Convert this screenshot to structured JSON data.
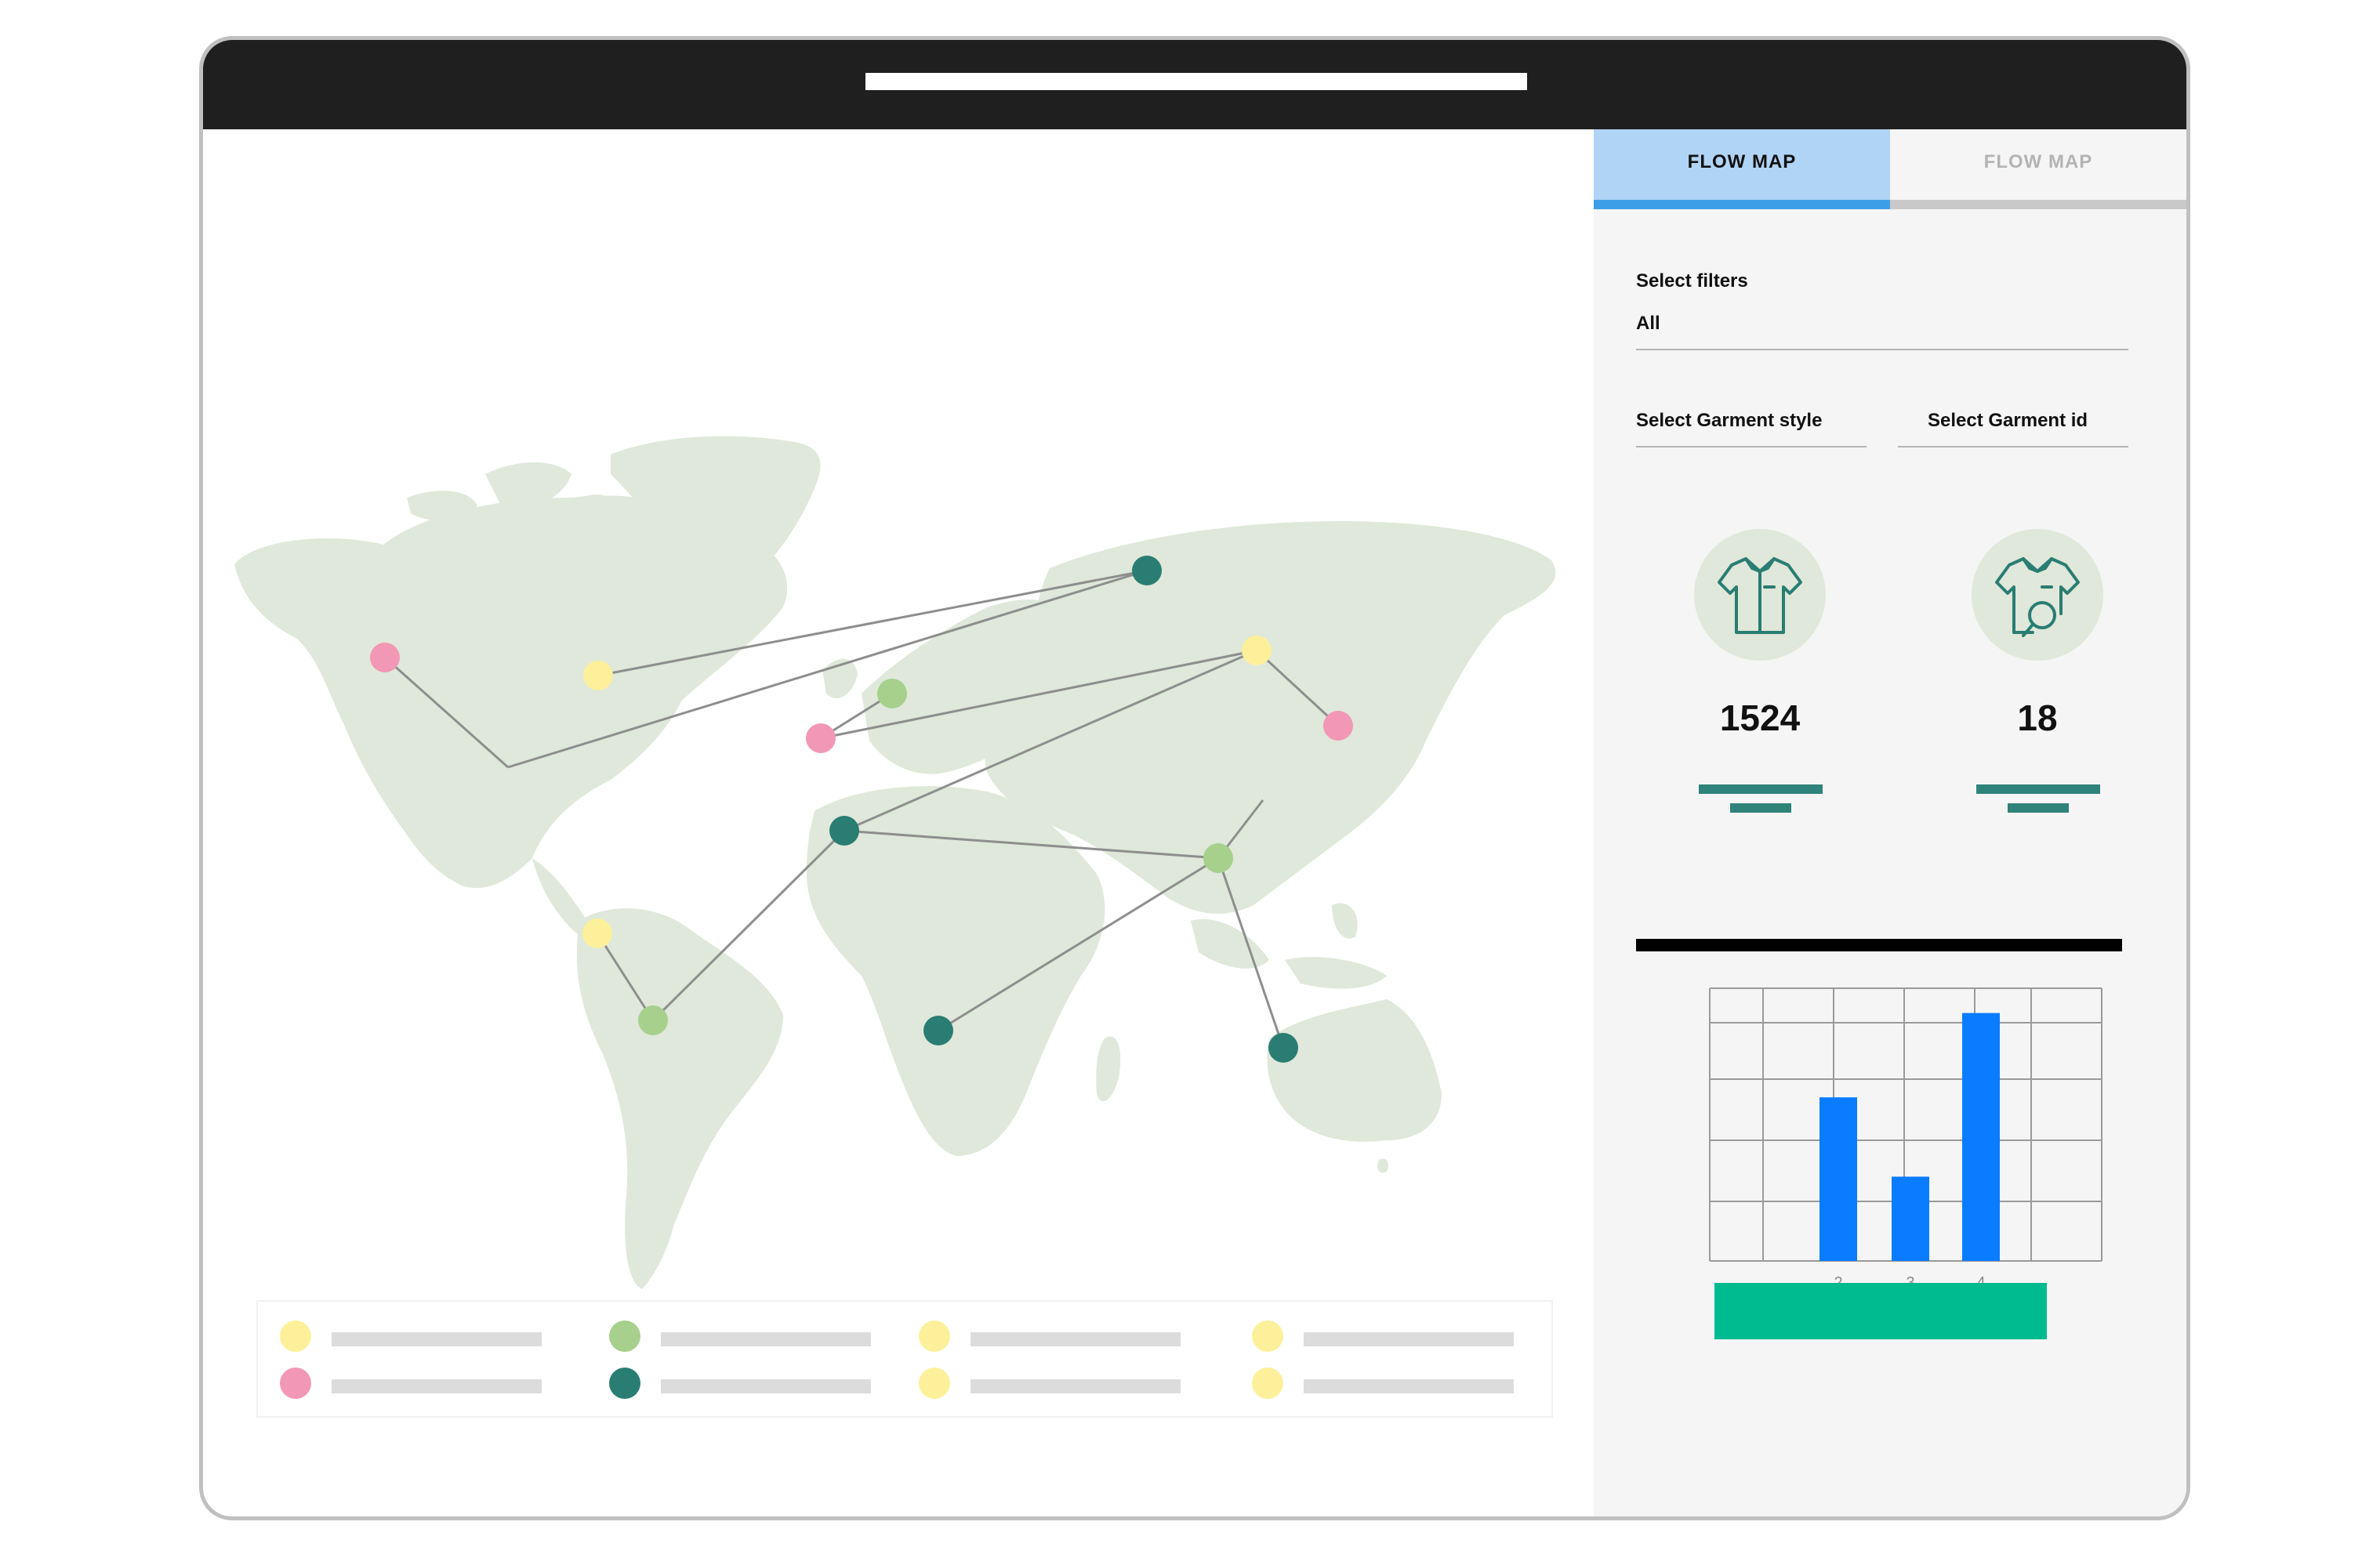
{
  "window": {
    "address_bar": ""
  },
  "colors": {
    "titlebar": "#1f1f1f",
    "land": "#dfe8da",
    "dot_yellow": "#fdf09a",
    "dot_pink": "#f297b5",
    "dot_light_green": "#a6d08c",
    "dot_teal": "#2a7d73",
    "route_line": "#8e8e8e",
    "tab_active_bg": "#b0d4f5",
    "tab_active_accent": "#3d9ee8",
    "chart_bar": "#0a7cff",
    "action_button": "#00bb8f"
  },
  "map": {
    "routes_count_shown": 15,
    "legend": [
      {
        "color": "dot_yellow",
        "label": ""
      },
      {
        "color": "dot_pink",
        "label": ""
      },
      {
        "color": "dot_light_green",
        "label": ""
      },
      {
        "color": "dot_teal",
        "label": ""
      },
      {
        "color": "dot_yellow",
        "label": ""
      },
      {
        "color": "dot_yellow",
        "label": ""
      },
      {
        "color": "dot_yellow",
        "label": ""
      },
      {
        "color": "dot_yellow",
        "label": ""
      }
    ]
  },
  "panel": {
    "tabs": [
      {
        "label": "FLOW MAP",
        "active": true
      },
      {
        "label": "FLOW MAP",
        "active": false
      }
    ],
    "filters": {
      "label": "Select filters",
      "value": "All"
    },
    "garment_style": {
      "label": "Select Garment style"
    },
    "garment_id": {
      "label": "Select Garment id"
    },
    "stats": [
      {
        "icon": "shirt-icon",
        "value": "1524"
      },
      {
        "icon": "shirt-search-icon",
        "value": "18"
      }
    ]
  },
  "chart_data": {
    "type": "bar",
    "categories": [
      "2",
      "3",
      "4"
    ],
    "values": [
      3.3,
      1.7,
      5
    ],
    "title": "",
    "xlabel": "",
    "ylabel": "",
    "ylim": [
      0,
      5.5
    ],
    "grid": true
  }
}
